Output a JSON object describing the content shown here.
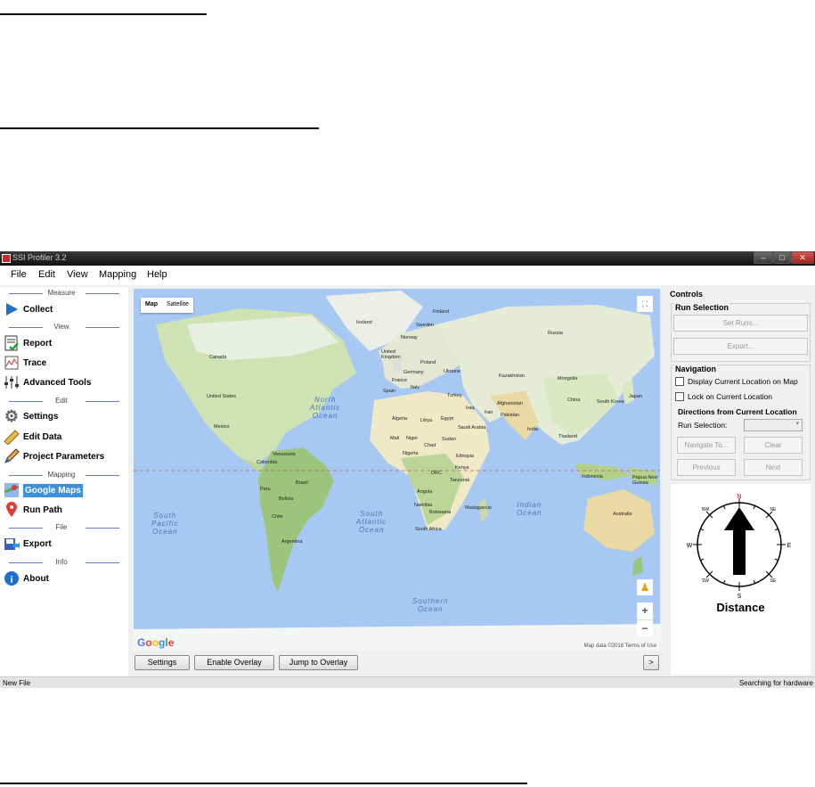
{
  "window": {
    "title": "SSI Profiler 3.2",
    "min": "–",
    "max": "□",
    "close": "✕"
  },
  "menu": [
    "File",
    "Edit",
    "View",
    "Mapping",
    "Help"
  ],
  "sidebar": {
    "sections": [
      "Measure",
      "View",
      "Edit",
      "Mapping",
      "File",
      "Info"
    ],
    "items": [
      {
        "label": "Collect",
        "icon": "play-icon"
      },
      {
        "label": "Report",
        "icon": "report-icon"
      },
      {
        "label": "Trace",
        "icon": "trace-icon"
      },
      {
        "label": "Advanced Tools",
        "icon": "sliders-icon"
      },
      {
        "label": "Settings",
        "icon": "gear-icon"
      },
      {
        "label": "Edit Data",
        "icon": "ruler-icon"
      },
      {
        "label": "Project Parameters",
        "icon": "pencil-icon"
      },
      {
        "label": "Google Maps",
        "icon": "map-icon",
        "active": true
      },
      {
        "label": "Run Path",
        "icon": "location-pin-icon"
      },
      {
        "label": "Export",
        "icon": "export-icon"
      },
      {
        "label": "About",
        "icon": "info-icon"
      }
    ],
    "collapse_label": "<"
  },
  "map": {
    "tab_map": "Map",
    "tab_satellite": "Satellite",
    "logo": "Google",
    "attribution": "Map data ©2018   Terms of Use",
    "zoom_in": "+",
    "zoom_out": "−",
    "oceans": {
      "north_atlantic": "North\nAtlantic\nOcean",
      "south_pacific": "South\nPacific\nOcean",
      "south_atlantic": "South\nAtlantic\nOcean",
      "indian": "Indian\nOcean",
      "southern": "Southern\nOcean"
    },
    "places": {
      "iceland": "Iceland",
      "finland": "Finland",
      "sweden": "Sweden",
      "norway": "Norway",
      "russia": "Russia",
      "uk": "United\nKingdom",
      "poland": "Poland",
      "germany": "Germany",
      "ukraine": "Ukraine",
      "france": "France",
      "spain": "Spain",
      "italy": "Italy",
      "turkey": "Turkey",
      "kazakhstan": "Kazakhstan",
      "mongolia": "Mongolia",
      "china": "China",
      "japan": "Japan",
      "south_korea": "South Korea",
      "canada": "Canada",
      "us": "United States",
      "mexico": "Mexico",
      "algeria": "Algeria",
      "libya": "Libya",
      "egypt": "Egypt",
      "iraq": "Iraq",
      "iran": "Iran",
      "afghanistan": "Afghanistan",
      "pakistan": "Pakistan",
      "india": "India",
      "saudi": "Saudi Arabia",
      "mali": "Mali",
      "niger": "Niger",
      "chad": "Chad",
      "sudan": "Sudan",
      "nigeria": "Nigeria",
      "ethiopia": "Ethiopia",
      "kenya": "Kenya",
      "drc": "DRC",
      "tanzania": "Tanzania",
      "angola": "Angola",
      "namibia": "Namibia",
      "botswana": "Botswana",
      "south_africa": "South Africa",
      "madagascar": "Madagascar",
      "thailand": "Thailand",
      "indonesia": "Indonesia",
      "png": "Papua New\nGuinea",
      "australia": "Australia",
      "venezuela": "Venezuela",
      "colombia": "Colombia",
      "peru": "Peru",
      "brazil": "Brazil",
      "bolivia": "Bolivia",
      "chile": "Chile",
      "argentina": "Argentina"
    }
  },
  "bottom_buttons": {
    "settings": "Settings",
    "enable_overlay": "Enable Overlay",
    "jump_overlay": "Jump to Overlay",
    "next": ">"
  },
  "controls": {
    "title": "Controls",
    "run_selection": {
      "title": "Run Selection",
      "set_runs": "Set Runs...",
      "export": "Export..."
    },
    "navigation": {
      "title": "Navigation",
      "display_current": "Display Current Location on Map",
      "lock_current": "Lock on Current Location",
      "directions_title": "Directions from Current Location",
      "run_selection_label": "Run Selection:",
      "run_selection_value": "",
      "navigate_to": "Navigate To...",
      "clear": "Clear",
      "previous": "Previous",
      "next": "Next"
    },
    "compass": {
      "n": "N",
      "s": "S",
      "e": "E",
      "w": "W",
      "ne": "NE",
      "nw": "NW",
      "se": "SE",
      "sw": "SW",
      "label": "Distance"
    }
  },
  "status": {
    "left": "New File",
    "right": "Searching for hardware"
  }
}
